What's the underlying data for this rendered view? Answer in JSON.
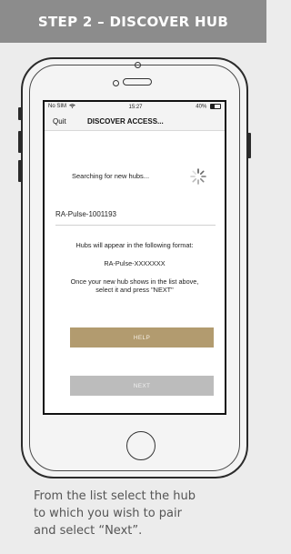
{
  "header": {
    "title": "STEP 2 – DISCOVER HUB"
  },
  "status_bar": {
    "carrier": "No SIM",
    "time": "15:27",
    "battery": "40%"
  },
  "nav": {
    "quit_label": "Quit",
    "title": "DISCOVER ACCESS..."
  },
  "search": {
    "text": "Searching for new hubs..."
  },
  "hubs": [
    {
      "name": "RA-Pulse-1001193"
    }
  ],
  "info": {
    "format_line": "Hubs will appear in the following format:",
    "format_example": "RA-Pulse-XXXXXXX",
    "instruction_line1": "Once your new hub shows in the list above,",
    "instruction_line2": "select it and press \"NEXT\""
  },
  "buttons": {
    "help_label": "HELP",
    "next_label": "NEXT"
  },
  "caption": {
    "line1": "From the list select the hub",
    "line2": "to which you wish to pair",
    "line3": "and select “Next”."
  },
  "colors": {
    "header_bg": "#8c8c8c",
    "help_button": "#b29b6f",
    "next_button": "#bcbcbc"
  },
  "icons": [
    "wifi-icon",
    "battery-icon",
    "loading-spinner-icon"
  ]
}
